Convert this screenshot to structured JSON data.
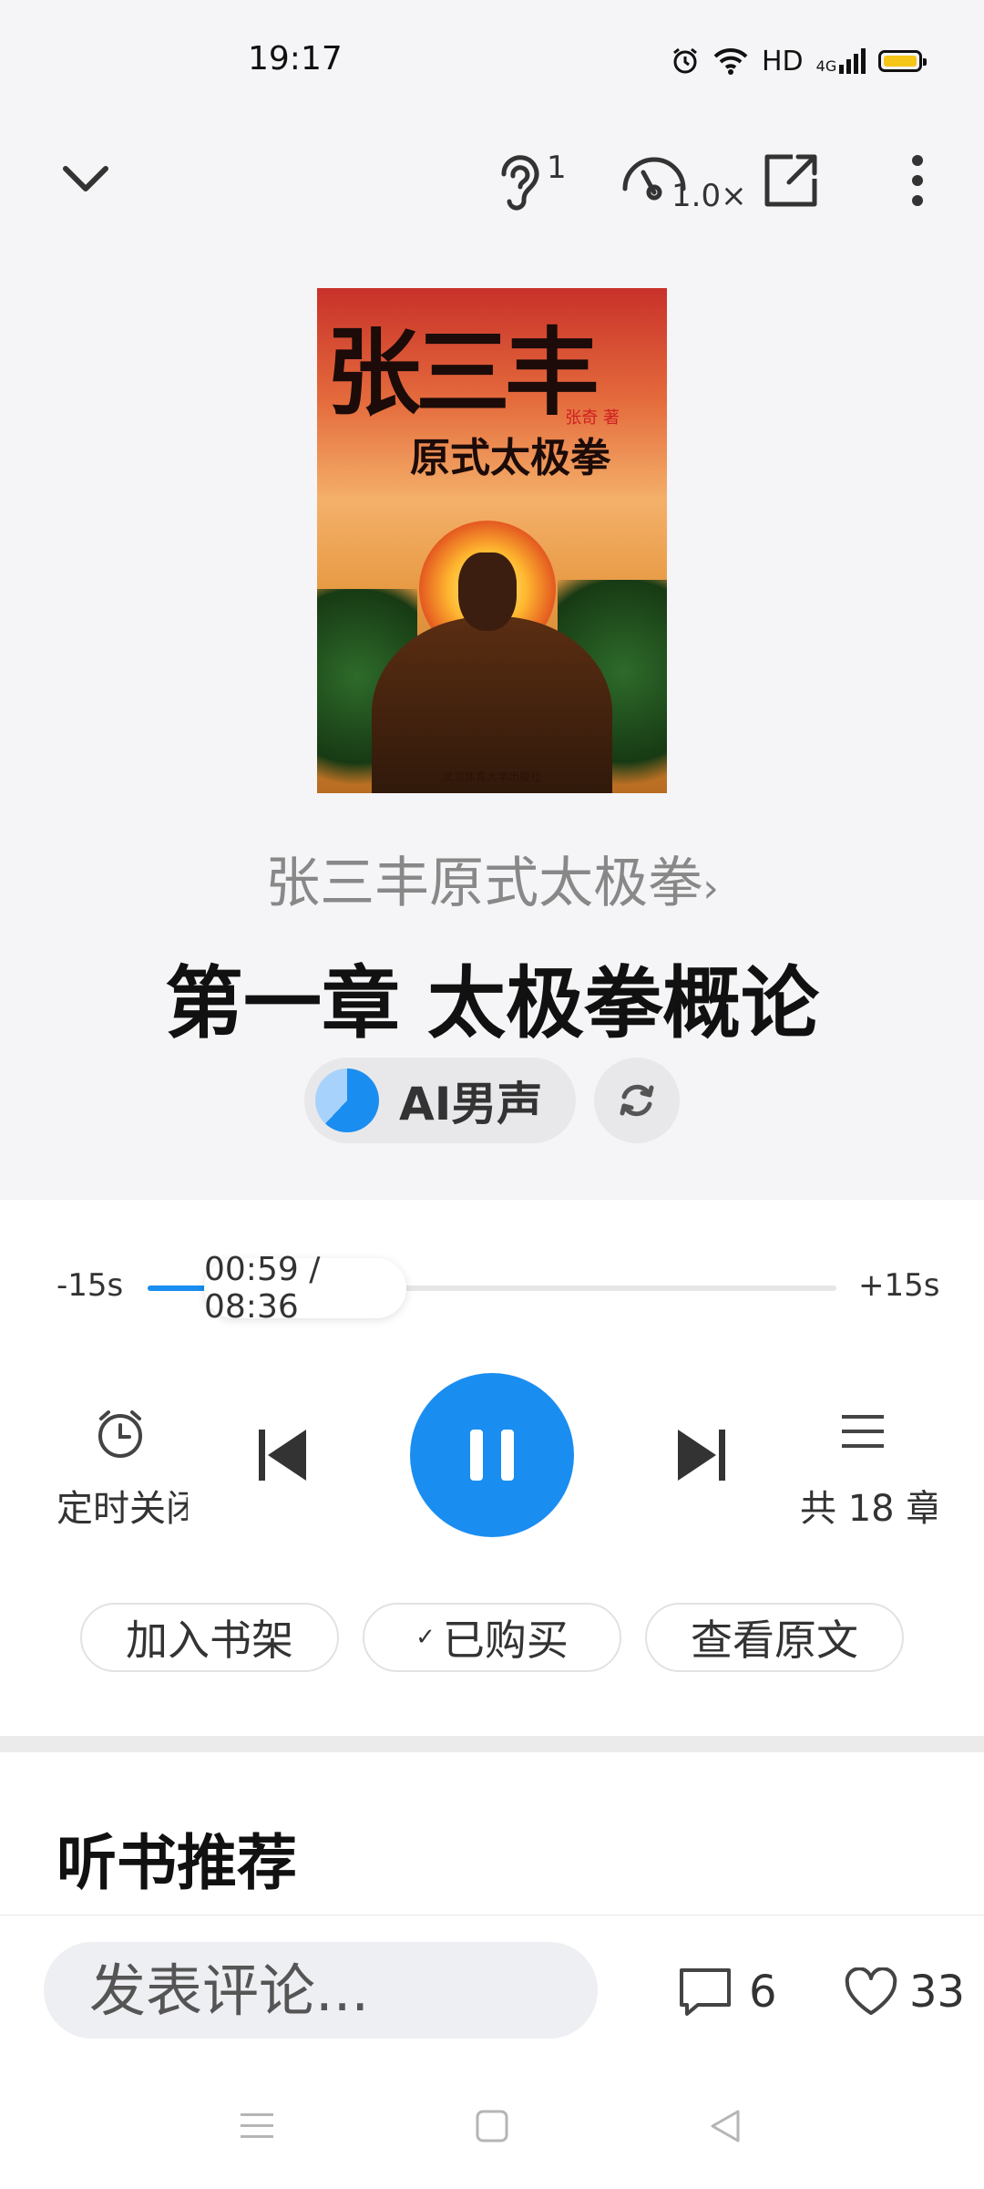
{
  "status_bar": {
    "time": "19:17",
    "network": "HD",
    "signal": "4G"
  },
  "top_bar": {
    "listener_count": "1",
    "speed": "1.0×"
  },
  "cover": {
    "title": "张三丰",
    "subtitle": "原式太极拳",
    "author": "张奇 著",
    "publisher": "北京体育大学出版社"
  },
  "book": {
    "title": "张三丰原式太极拳",
    "chapter": "第一章 太极拳概论"
  },
  "voice": {
    "label": "AI男声"
  },
  "player": {
    "rewind_label": "-15s",
    "forward_label": "+15s",
    "time_display": "00:59 / 08:36",
    "progress": 0.11,
    "timer_label": "定时关闭",
    "chapters_label": "共 18 章"
  },
  "actions": {
    "add_shelf": "加入书架",
    "purchased": "已购买",
    "view_original": "查看原文"
  },
  "recommend": {
    "title": "听书推荐"
  },
  "comment_bar": {
    "placeholder": "发表评论...",
    "comment_count": "6",
    "like_count": "33"
  },
  "colors": {
    "accent": "#1a8df0",
    "background": "#f5f5f7"
  }
}
